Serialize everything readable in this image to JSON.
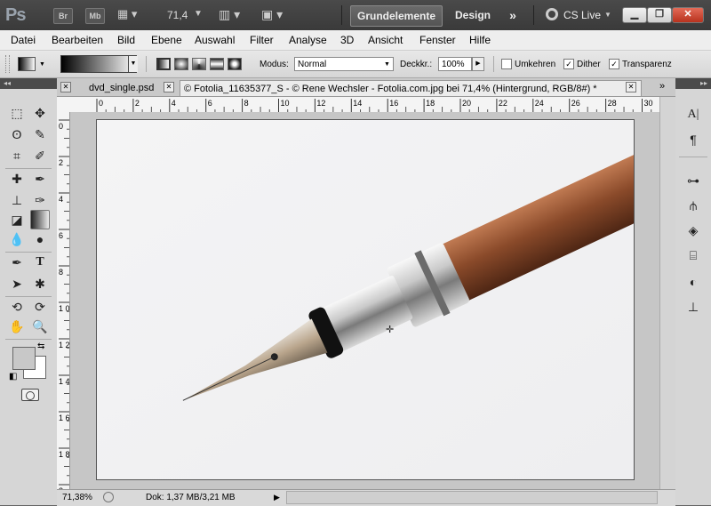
{
  "app_bar": {
    "logo": "Ps",
    "bridge_btn": "Br",
    "minibridge_btn": "Mb",
    "zoom": "71,4",
    "workspaces": [
      "Grundelemente",
      "Design"
    ],
    "more": "»",
    "cs_live": "CS Live"
  },
  "menu": [
    "Datei",
    "Bearbeiten",
    "Bild",
    "Ebene",
    "Auswahl",
    "Filter",
    "Analyse",
    "3D",
    "Ansicht",
    "Fenster",
    "Hilfe"
  ],
  "options": {
    "modus_label": "Modus:",
    "modus_value": "Normal",
    "deckkr_label": "Deckkr.:",
    "deckkr_value": "100%",
    "umkehren": "Umkehren",
    "dither": "Dither",
    "transparenz": "Transparenz",
    "umkehren_checked": false,
    "dither_checked": true,
    "transparenz_checked": true
  },
  "tabs": [
    {
      "label": "dvd_single.psd",
      "active": false
    },
    {
      "label": "© Fotolia_11635377_S - © Rene Wechsler - Fotolia.com.jpg bei 71,4% (Hintergrund, RGB/8#) *",
      "active": true
    }
  ],
  "ruler_h": [
    "0",
    "2",
    "4",
    "6",
    "8",
    "10",
    "12",
    "14",
    "16",
    "18",
    "20",
    "22",
    "24",
    "26",
    "28",
    "30"
  ],
  "ruler_v": [
    "0",
    "2",
    "4",
    "6",
    "8",
    "1 0",
    "1 2",
    "1 4",
    "1 6",
    "1 8",
    "2"
  ],
  "status": {
    "zoom": "71,38%",
    "doc": "Dok: 1,37 MB/3,21 MB"
  },
  "colors": {
    "foreground": "#c8c8c8",
    "background": "#ffffff"
  }
}
